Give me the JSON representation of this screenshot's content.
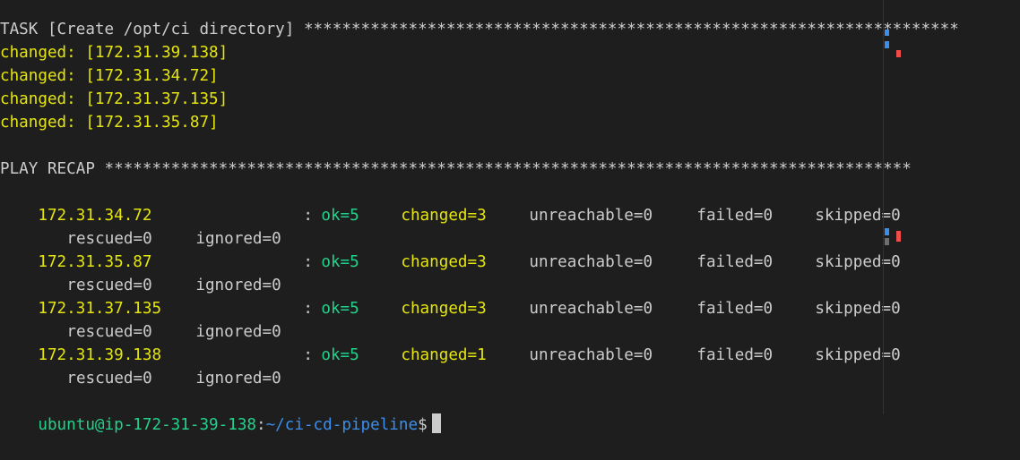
{
  "task_line": {
    "text": "TASK [Create /opt/ci directory] *********************************************************************"
  },
  "changed_lines": [
    "changed: [172.31.39.138]",
    "changed: [172.31.34.72]",
    "changed: [172.31.37.135]",
    "changed: [172.31.35.87]"
  ],
  "recap_header": "PLAY RECAP *************************************************************************************",
  "recap_rows": [
    {
      "host": "172.31.34.72",
      "colon": ":",
      "ok": "ok=5",
      "changed": "changed=3",
      "unreachable": "unreachable=0",
      "failed": "failed=0",
      "skipped": "skipped=0",
      "rescued": "rescued=0",
      "ignored": "ignored=0"
    },
    {
      "host": "172.31.35.87",
      "colon": ":",
      "ok": "ok=5",
      "changed": "changed=3",
      "unreachable": "unreachable=0",
      "failed": "failed=0",
      "skipped": "skipped=0",
      "rescued": "rescued=0",
      "ignored": "ignored=0"
    },
    {
      "host": "172.31.37.135",
      "colon": ":",
      "ok": "ok=5",
      "changed": "changed=3",
      "unreachable": "unreachable=0",
      "failed": "failed=0",
      "skipped": "skipped=0",
      "rescued": "rescued=0",
      "ignored": "ignored=0"
    },
    {
      "host": "172.31.39.138",
      "colon": ":",
      "ok": "ok=5",
      "changed": "changed=1",
      "unreachable": "unreachable=0",
      "failed": "failed=0",
      "skipped": "skipped=0",
      "rescued": "rescued=0",
      "ignored": "ignored=0"
    }
  ],
  "prompt": {
    "user_host": "ubuntu@ip-172-31-39-138",
    "separator": ":",
    "path": "~/ci-cd-pipeline",
    "symbol": "$"
  },
  "colors": {
    "background": "#1e1e1e",
    "yellow": "#e5e510",
    "green": "#23d18b",
    "blue": "#3b8eea",
    "default_text": "#cccccc",
    "marker_blue": "#3b8eea",
    "marker_red": "#f14c4c",
    "marker_gray": "#6e6e6e"
  }
}
